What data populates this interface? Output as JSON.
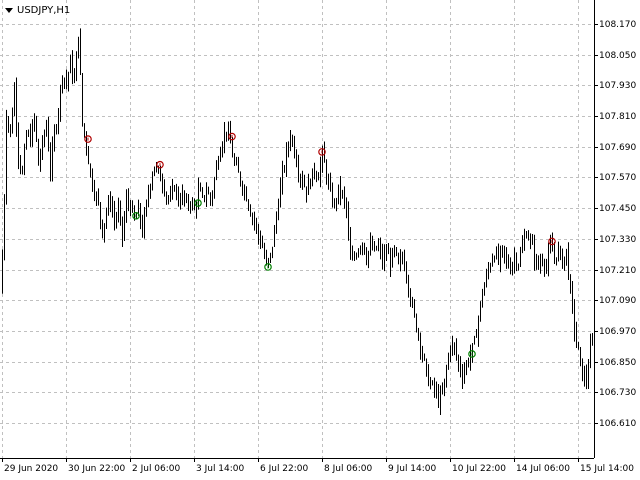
{
  "window": {
    "symbol_title": "USDJPY,H1"
  },
  "price_axis": {
    "labels": [
      "108.170",
      "108.050",
      "107.930",
      "107.810",
      "107.690",
      "107.570",
      "107.450",
      "107.330",
      "107.210",
      "107.090",
      "106.970",
      "106.850",
      "106.730",
      "106.610"
    ]
  },
  "time_axis": {
    "labels": [
      "29 Jun 2020",
      "30 Jun 22:00",
      "2 Jul 06:00",
      "3 Jul 14:00",
      "6 Jul 22:00",
      "8 Jul 06:00",
      "9 Jul 14:00",
      "10 Jul 22:00",
      "14 Jul 06:00",
      "15 Jul 14:00"
    ]
  },
  "colors": {
    "background": "#ffffff",
    "grid": "#c0c0c0",
    "bars": "#000000",
    "sell_signal": "#b00000",
    "buy_signal": "#008000"
  },
  "chart_data": {
    "type": "ohlc",
    "symbol": "USDJPY",
    "timeframe": "H1",
    "ylim": [
      106.58,
      108.2
    ],
    "grid": true,
    "close_path": [
      [
        0,
        107.12
      ],
      [
        3,
        107.34
      ],
      [
        6,
        107.82
      ],
      [
        10,
        107.74
      ],
      [
        14,
        107.92
      ],
      [
        18,
        107.66
      ],
      [
        22,
        107.58
      ],
      [
        26,
        107.74
      ],
      [
        30,
        107.72
      ],
      [
        34,
        107.8
      ],
      [
        38,
        107.62
      ],
      [
        42,
        107.7
      ],
      [
        46,
        107.78
      ],
      [
        50,
        107.6
      ],
      [
        54,
        107.74
      ],
      [
        58,
        107.84
      ],
      [
        62,
        107.98
      ],
      [
        66,
        107.94
      ],
      [
        70,
        108.02
      ],
      [
        74,
        107.94
      ],
      [
        78,
        108.14
      ],
      [
        82,
        107.78
      ],
      [
        86,
        107.7
      ],
      [
        90,
        107.58
      ],
      [
        94,
        107.52
      ],
      [
        98,
        107.46
      ],
      [
        102,
        107.36
      ],
      [
        106,
        107.44
      ],
      [
        110,
        107.48
      ],
      [
        114,
        107.4
      ],
      [
        118,
        107.44
      ],
      [
        122,
        107.34
      ],
      [
        126,
        107.48
      ],
      [
        130,
        107.46
      ],
      [
        134,
        107.4
      ],
      [
        138,
        107.44
      ],
      [
        142,
        107.36
      ],
      [
        146,
        107.46
      ],
      [
        150,
        107.56
      ],
      [
        154,
        107.62
      ],
      [
        158,
        107.58
      ],
      [
        162,
        107.56
      ],
      [
        166,
        107.5
      ],
      [
        170,
        107.48
      ],
      [
        174,
        107.54
      ],
      [
        178,
        107.48
      ],
      [
        182,
        107.5
      ],
      [
        186,
        107.46
      ],
      [
        190,
        107.48
      ],
      [
        194,
        107.44
      ],
      [
        198,
        107.52
      ],
      [
        202,
        107.48
      ],
      [
        206,
        107.52
      ],
      [
        210,
        107.48
      ],
      [
        214,
        107.56
      ],
      [
        218,
        107.66
      ],
      [
        222,
        107.72
      ],
      [
        226,
        107.76
      ],
      [
        230,
        107.7
      ],
      [
        234,
        107.62
      ],
      [
        238,
        107.58
      ],
      [
        242,
        107.54
      ],
      [
        246,
        107.5
      ],
      [
        250,
        107.44
      ],
      [
        254,
        107.4
      ],
      [
        258,
        107.34
      ],
      [
        262,
        107.3
      ],
      [
        266,
        107.22
      ],
      [
        270,
        107.26
      ],
      [
        274,
        107.36
      ],
      [
        278,
        107.48
      ],
      [
        282,
        107.58
      ],
      [
        286,
        107.66
      ],
      [
        290,
        107.74
      ],
      [
        294,
        107.68
      ],
      [
        298,
        107.6
      ],
      [
        302,
        107.56
      ],
      [
        306,
        107.52
      ],
      [
        310,
        107.56
      ],
      [
        314,
        107.6
      ],
      [
        318,
        107.58
      ],
      [
        322,
        107.66
      ],
      [
        326,
        107.58
      ],
      [
        330,
        107.5
      ],
      [
        334,
        107.46
      ],
      [
        338,
        107.52
      ],
      [
        342,
        107.5
      ],
      [
        346,
        107.44
      ],
      [
        350,
        107.24
      ],
      [
        354,
        107.26
      ],
      [
        358,
        107.3
      ],
      [
        362,
        107.32
      ],
      [
        366,
        107.26
      ],
      [
        370,
        107.3
      ],
      [
        374,
        107.28
      ],
      [
        378,
        107.3
      ],
      [
        382,
        107.24
      ],
      [
        386,
        107.28
      ],
      [
        390,
        107.24
      ],
      [
        394,
        107.28
      ],
      [
        398,
        107.22
      ],
      [
        402,
        107.26
      ],
      [
        406,
        107.2
      ],
      [
        410,
        107.1
      ],
      [
        414,
        107.02
      ],
      [
        418,
        106.96
      ],
      [
        422,
        106.88
      ],
      [
        426,
        106.8
      ],
      [
        430,
        106.76
      ],
      [
        434,
        106.74
      ],
      [
        438,
        106.7
      ],
      [
        442,
        106.72
      ],
      [
        446,
        106.82
      ],
      [
        450,
        106.92
      ],
      [
        454,
        106.9
      ],
      [
        458,
        106.84
      ],
      [
        462,
        106.8
      ],
      [
        466,
        106.84
      ],
      [
        470,
        106.88
      ],
      [
        474,
        106.92
      ],
      [
        478,
        107.02
      ],
      [
        482,
        107.12
      ],
      [
        486,
        107.18
      ],
      [
        490,
        107.24
      ],
      [
        494,
        107.28
      ],
      [
        498,
        107.24
      ],
      [
        502,
        107.28
      ],
      [
        506,
        107.24
      ],
      [
        510,
        107.22
      ],
      [
        514,
        107.26
      ],
      [
        518,
        107.24
      ],
      [
        522,
        107.3
      ],
      [
        526,
        107.36
      ],
      [
        530,
        107.32
      ],
      [
        534,
        107.26
      ],
      [
        538,
        107.22
      ],
      [
        542,
        107.26
      ],
      [
        546,
        107.22
      ],
      [
        550,
        107.3
      ],
      [
        554,
        107.26
      ],
      [
        558,
        107.28
      ],
      [
        562,
        107.24
      ],
      [
        566,
        107.28
      ],
      [
        570,
        107.12
      ],
      [
        574,
        106.98
      ],
      [
        578,
        106.88
      ],
      [
        582,
        106.8
      ],
      [
        586,
        106.78
      ],
      [
        590,
        106.9
      ],
      [
        594,
        106.94
      ]
    ],
    "sell_signals": [
      [
        88,
        107.72
      ],
      [
        160,
        107.62
      ],
      [
        232,
        107.73
      ],
      [
        322,
        107.67
      ],
      [
        552,
        107.32
      ]
    ],
    "buy_signals": [
      [
        136,
        107.42
      ],
      [
        198,
        107.47
      ],
      [
        268,
        107.22
      ],
      [
        472,
        106.88
      ]
    ]
  }
}
